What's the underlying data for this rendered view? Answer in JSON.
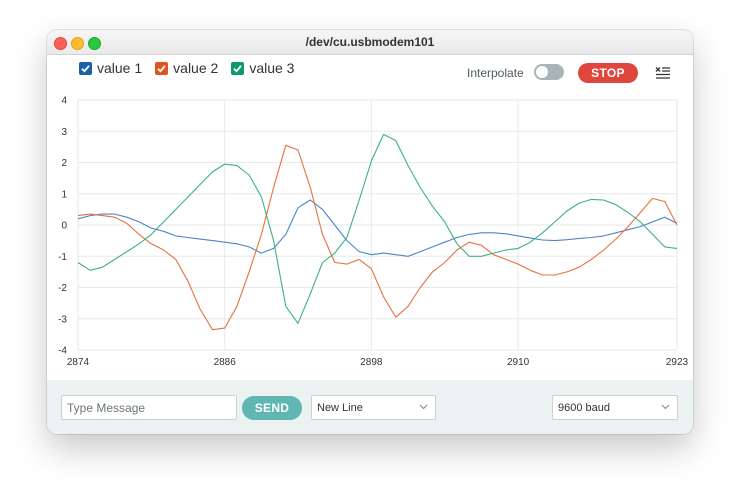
{
  "window": {
    "title": "/dev/cu.usbmodem101"
  },
  "legend": {
    "items": [
      {
        "label": "value 1",
        "color": "#1f5fa8",
        "checked": true
      },
      {
        "label": "value 2",
        "color": "#e0541e",
        "checked": true
      },
      {
        "label": "value 3",
        "color": "#0f9a6c",
        "checked": true
      }
    ]
  },
  "toolbar": {
    "interpolate_label": "Interpolate",
    "interpolate_on": false,
    "stop_label": "STOP",
    "clear_icon": "clear-list-icon"
  },
  "chart_data": {
    "type": "line",
    "xlim": [
      2874,
      2923
    ],
    "ylim": [
      -4,
      4
    ],
    "xticks": [
      "2874",
      "2886",
      "2898",
      "2910",
      "2923"
    ],
    "yticks": [
      "4",
      "3",
      "2",
      "1",
      "0",
      "-1",
      "-2",
      "-3",
      "-4"
    ],
    "grid": true,
    "x": [
      2874,
      2875,
      2876,
      2877,
      2878,
      2879,
      2880,
      2881,
      2882,
      2883,
      2884,
      2885,
      2886,
      2887,
      2888,
      2889,
      2890,
      2891,
      2892,
      2893,
      2894,
      2895,
      2896,
      2897,
      2898,
      2899,
      2900,
      2901,
      2902,
      2903,
      2904,
      2905,
      2906,
      2907,
      2908,
      2909,
      2910,
      2911,
      2912,
      2913,
      2914,
      2915,
      2916,
      2917,
      2918,
      2919,
      2920,
      2921,
      2922,
      2923
    ],
    "series": [
      {
        "name": "value 1",
        "color": "#4a86c5",
        "values": [
          0.2,
          0.3,
          0.35,
          0.35,
          0.25,
          0.1,
          -0.1,
          -0.2,
          -0.35,
          -0.4,
          -0.45,
          -0.5,
          -0.55,
          -0.6,
          -0.7,
          -0.9,
          -0.75,
          -0.3,
          0.55,
          0.8,
          0.5,
          0.0,
          -0.5,
          -0.85,
          -0.95,
          -0.9,
          -0.95,
          -1.0,
          -0.85,
          -0.7,
          -0.55,
          -0.4,
          -0.3,
          -0.25,
          -0.25,
          -0.28,
          -0.35,
          -0.42,
          -0.48,
          -0.5,
          -0.47,
          -0.43,
          -0.4,
          -0.35,
          -0.25,
          -0.15,
          -0.05,
          0.1,
          0.25,
          0.05
        ]
      },
      {
        "name": "value 2",
        "color": "#e8703f",
        "values": [
          0.3,
          0.35,
          0.3,
          0.25,
          0.05,
          -0.3,
          -0.6,
          -0.8,
          -1.1,
          -1.8,
          -2.7,
          -3.35,
          -3.3,
          -2.6,
          -1.5,
          -0.3,
          1.2,
          2.55,
          2.4,
          1.2,
          -0.3,
          -1.2,
          -1.25,
          -1.1,
          -1.4,
          -2.3,
          -2.95,
          -2.6,
          -2.0,
          -1.5,
          -1.2,
          -0.8,
          -0.55,
          -0.65,
          -0.95,
          -1.1,
          -1.25,
          -1.45,
          -1.6,
          -1.6,
          -1.5,
          -1.35,
          -1.1,
          -0.8,
          -0.45,
          -0.05,
          0.4,
          0.85,
          0.75,
          0.0
        ]
      },
      {
        "name": "value 3",
        "color": "#3fae8a",
        "values": [
          -1.2,
          -1.45,
          -1.35,
          -1.1,
          -0.85,
          -0.6,
          -0.3,
          0.1,
          0.5,
          0.9,
          1.3,
          1.7,
          1.95,
          1.9,
          1.6,
          0.9,
          -0.5,
          -2.6,
          -3.15,
          -2.2,
          -1.2,
          -0.9,
          -0.4,
          0.8,
          2.05,
          2.9,
          2.7,
          1.9,
          1.2,
          0.6,
          0.1,
          -0.6,
          -1.0,
          -1.0,
          -0.9,
          -0.8,
          -0.75,
          -0.55,
          -0.25,
          0.1,
          0.45,
          0.7,
          0.82,
          0.8,
          0.65,
          0.4,
          0.1,
          -0.3,
          -0.7,
          -0.75
        ]
      }
    ]
  },
  "footer": {
    "message_placeholder": "Type Message",
    "send_label": "SEND",
    "line_ending": "New Line",
    "baud_rate": "9600 baud"
  }
}
